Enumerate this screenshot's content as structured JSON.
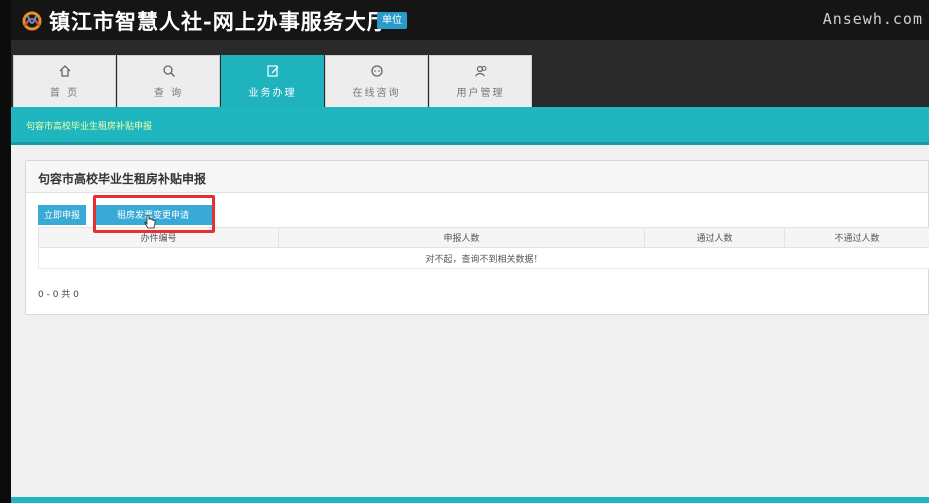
{
  "header": {
    "title": "镇江市智慧人社-网上办事服务大厅",
    "unit_badge": "单位",
    "watermark": "Ansewh.com",
    "logo_icon": "ribbon-logo-icon"
  },
  "nav": {
    "tabs": [
      {
        "label": "首 页",
        "icon": "home-icon",
        "active": false
      },
      {
        "label": "查 询",
        "icon": "search-icon",
        "active": false
      },
      {
        "label": "业务办理",
        "icon": "edit-icon",
        "active": true
      },
      {
        "label": "在线咨询",
        "icon": "chat-icon",
        "active": false
      },
      {
        "label": "用户管理",
        "icon": "users-icon",
        "active": false
      }
    ]
  },
  "breadcrumb": "句容市高校毕业生租房补贴申报",
  "panel": {
    "title": "句容市高校毕业生租房补贴申报",
    "apply_now_label": "立即申报",
    "invoice_apply_label": "租房发票变更申请",
    "table": {
      "headers": [
        "办件编号",
        "申报人数",
        "通过人数",
        "不通过人数"
      ],
      "empty_message": "对不起，查询不到相关数据！"
    },
    "pager_text": "0 - 0 共 0"
  },
  "colors": {
    "accent": "#20b6bf",
    "button": "#39a9d6",
    "highlight": "#e53030"
  }
}
